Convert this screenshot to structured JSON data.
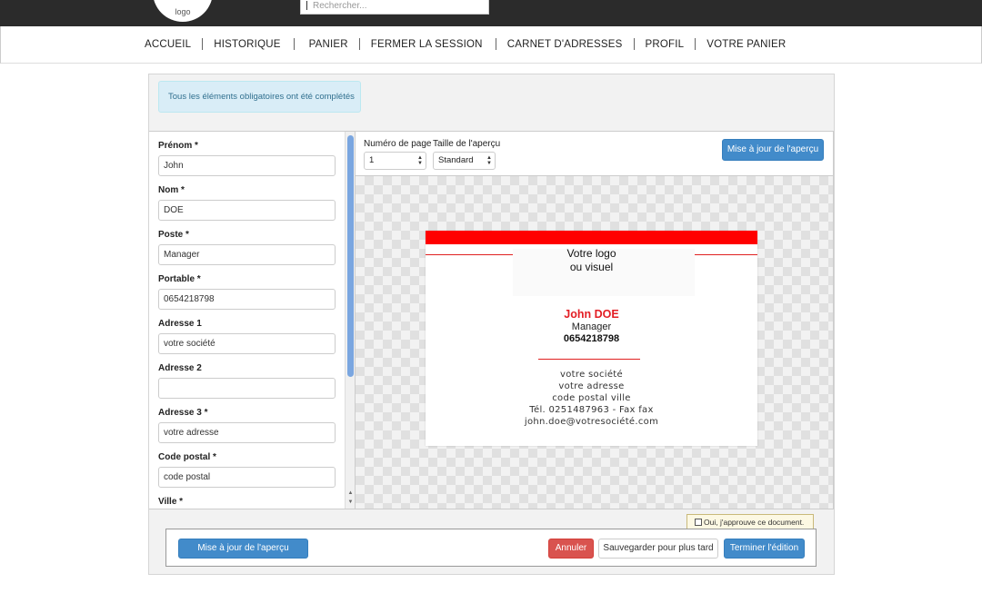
{
  "header": {
    "logo_text": "logo",
    "search_placeholder": "Rechercher..."
  },
  "nav": {
    "items": [
      "ACCUEIL",
      "HISTORIQUE",
      "PANIER",
      "FERMER LA SESSION",
      "CARNET D'ADRESSES",
      "PROFIL",
      "VOTRE PANIER"
    ]
  },
  "alert": {
    "text": "Tous les éléments obligatoires ont été complétés"
  },
  "form": {
    "fields": [
      {
        "label": "Prénom *",
        "value": "John"
      },
      {
        "label": "Nom *",
        "value": "DOE"
      },
      {
        "label": "Poste *",
        "value": "Manager"
      },
      {
        "label": "Portable *",
        "value": "0654218798"
      },
      {
        "label": "Adresse 1",
        "value": "votre société"
      },
      {
        "label": "Adresse 2",
        "value": ""
      },
      {
        "label": "Adresse 3 *",
        "value": "votre adresse"
      },
      {
        "label": "Code postal *",
        "value": "code postal"
      },
      {
        "label": "Ville *",
        "value": ""
      }
    ]
  },
  "preview_toolbar": {
    "page_number_label": "Numéro de page",
    "page_number_value": "1",
    "preview_size_label": "Taille de l'aperçu",
    "preview_size_value": "Standard",
    "update_button": "Mise à jour de l'aperçu"
  },
  "card": {
    "logo_line1": "Votre logo",
    "logo_line2": "ou visuel",
    "name": "John DOE",
    "job": "Manager",
    "phone": "0654218798",
    "address_lines": [
      "votre société",
      "votre adresse",
      "code postal ville",
      "Tél. 0251487963 - Fax fax",
      "john.doe@votresociété.com"
    ],
    "accent_color": "#ff0000"
  },
  "approval": {
    "text": "Oui, j'approuve ce document."
  },
  "footer": {
    "update_button": "Mise à jour de l'aperçu",
    "cancel_button": "Annuler",
    "save_later_button": "Sauvegarder pour plus tard",
    "finish_button": "Terminer l'édition"
  }
}
